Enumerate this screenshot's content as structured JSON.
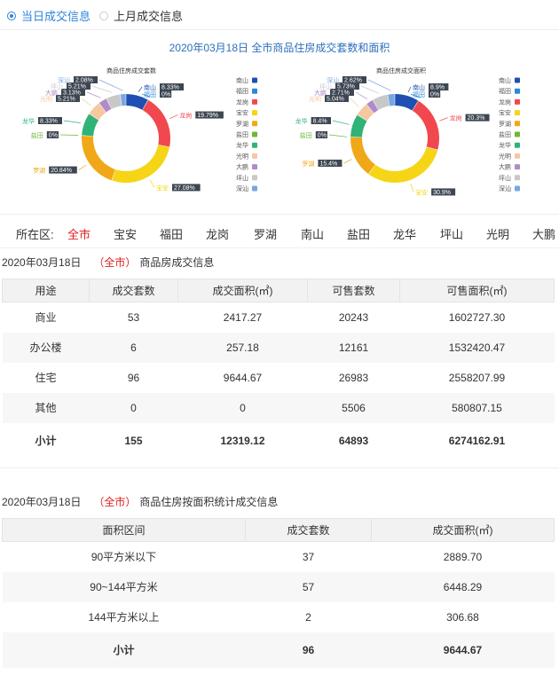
{
  "tabs": [
    {
      "label": "当日成交信息",
      "active": true
    },
    {
      "label": "上月成交信息",
      "active": false
    }
  ],
  "chart_header": "2020年03月18日 全市商品住房成交套数和面积",
  "chart_data": [
    {
      "type": "pie",
      "title": "商品住房成交套数",
      "labels": [
        "南山",
        "福田",
        "龙岗",
        "宝安",
        "罗湖",
        "盐田",
        "龙华",
        "光明",
        "大鹏",
        "坪山",
        "深汕"
      ],
      "values": [
        8.33,
        0,
        19.79,
        27.08,
        20.84,
        0,
        8.33,
        5.21,
        3.13,
        5.21,
        2.08
      ],
      "value_labels": [
        "8.33%",
        "0%",
        "19.79%",
        "27.08%",
        "20.84%",
        "0%",
        "8.33%",
        "5.21%",
        "3.13%",
        "5.21%",
        "2.08%"
      ]
    },
    {
      "type": "pie",
      "title": "商品住房成交面积",
      "labels": [
        "南山",
        "福田",
        "龙岗",
        "宝安",
        "罗湖",
        "盐田",
        "龙华",
        "光明",
        "大鹏",
        "坪山",
        "深汕"
      ],
      "values": [
        8.9,
        0,
        20.3,
        30.9,
        15.4,
        0,
        8.4,
        5.04,
        2.71,
        5.73,
        2.62
      ],
      "value_labels": [
        "8.9%",
        "0%",
        "20.3%",
        "30.9%",
        "15.4%",
        "0%",
        "8.4%",
        "5.04%",
        "2.71%",
        "5.73%",
        "2.62%"
      ]
    }
  ],
  "colors": [
    "#1f4fb3",
    "#2a8ad6",
    "#f0484e",
    "#f5d516",
    "#f0a818",
    "#6cb832",
    "#2fb376",
    "#f5c8a0",
    "#b08bc8",
    "#c8c8c8",
    "#7aa6e0"
  ],
  "district_bar": {
    "label": "所在区:",
    "items": [
      "全市",
      "宝安",
      "福田",
      "龙岗",
      "罗湖",
      "南山",
      "盐田",
      "龙华",
      "坪山",
      "光明",
      "大鹏"
    ],
    "active_index": 0
  },
  "section1": {
    "date": "2020年03月18日",
    "area": "（全市）",
    "title": "商品房成交信息",
    "headers": [
      "用途",
      "成交套数",
      "成交面积(㎡)",
      "可售套数",
      "可售面积(㎡)"
    ],
    "rows": [
      [
        "商业",
        "53",
        "2417.27",
        "20243",
        "1602727.30"
      ],
      [
        "办公楼",
        "6",
        "257.18",
        "12161",
        "1532420.47"
      ],
      [
        "住宅",
        "96",
        "9644.67",
        "26983",
        "2558207.99"
      ],
      [
        "其他",
        "0",
        "0",
        "5506",
        "580807.15"
      ]
    ],
    "total": [
      "小计",
      "155",
      "12319.12",
      "64893",
      "6274162.91"
    ]
  },
  "section2": {
    "date": "2020年03月18日",
    "area": "（全市）",
    "title": "商品住房按面积统计成交信息",
    "headers": [
      "面积区间",
      "成交套数",
      "成交面积(㎡)"
    ],
    "rows": [
      [
        "90平方米以下",
        "37",
        "2889.70"
      ],
      [
        "90~144平方米",
        "57",
        "6448.29"
      ],
      [
        "144平方米以上",
        "2",
        "306.68"
      ]
    ],
    "total": [
      "小计",
      "96",
      "9644.67"
    ]
  }
}
